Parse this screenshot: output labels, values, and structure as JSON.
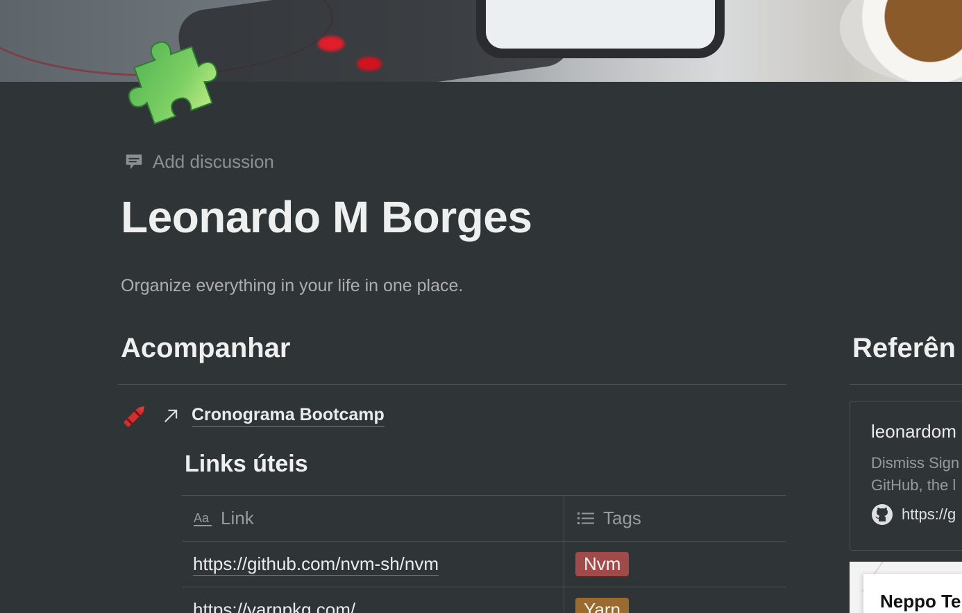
{
  "page": {
    "discussion_label": "Add discussion",
    "title": "Leonardo M Borges",
    "subtitle": "Organize everything in your life in one place."
  },
  "acompanhar": {
    "heading": "Acompanhar",
    "linked_page": "Cronograma Bootcamp"
  },
  "links_uteis": {
    "heading": "Links úteis",
    "columns": [
      "Link",
      "Tags"
    ],
    "rows": [
      {
        "link": "https://github.com/nvm-sh/nvm",
        "tag": "Nvm",
        "tag_color": "#a04a4a"
      },
      {
        "link": "https://yarnpkg.com/",
        "tag": "Yarn",
        "tag_color": "#9a6a30"
      }
    ]
  },
  "referencias": {
    "heading": "Referên",
    "bookmark": {
      "title": "leonardom",
      "description_line1": "Dismiss Sign",
      "description_line2": "GitHub, the l",
      "url": "https://g"
    },
    "card2_label": "Neppo Te"
  },
  "icons": {
    "page_icon": "puzzle-piece-icon",
    "discussion": "comment-icon",
    "linked_page": "crayon-icon",
    "link_arrow": "arrow-up-right-icon",
    "title_property": "text-aa-icon",
    "multi_select_property": "list-icon",
    "bookmark_site": "github-icon"
  }
}
